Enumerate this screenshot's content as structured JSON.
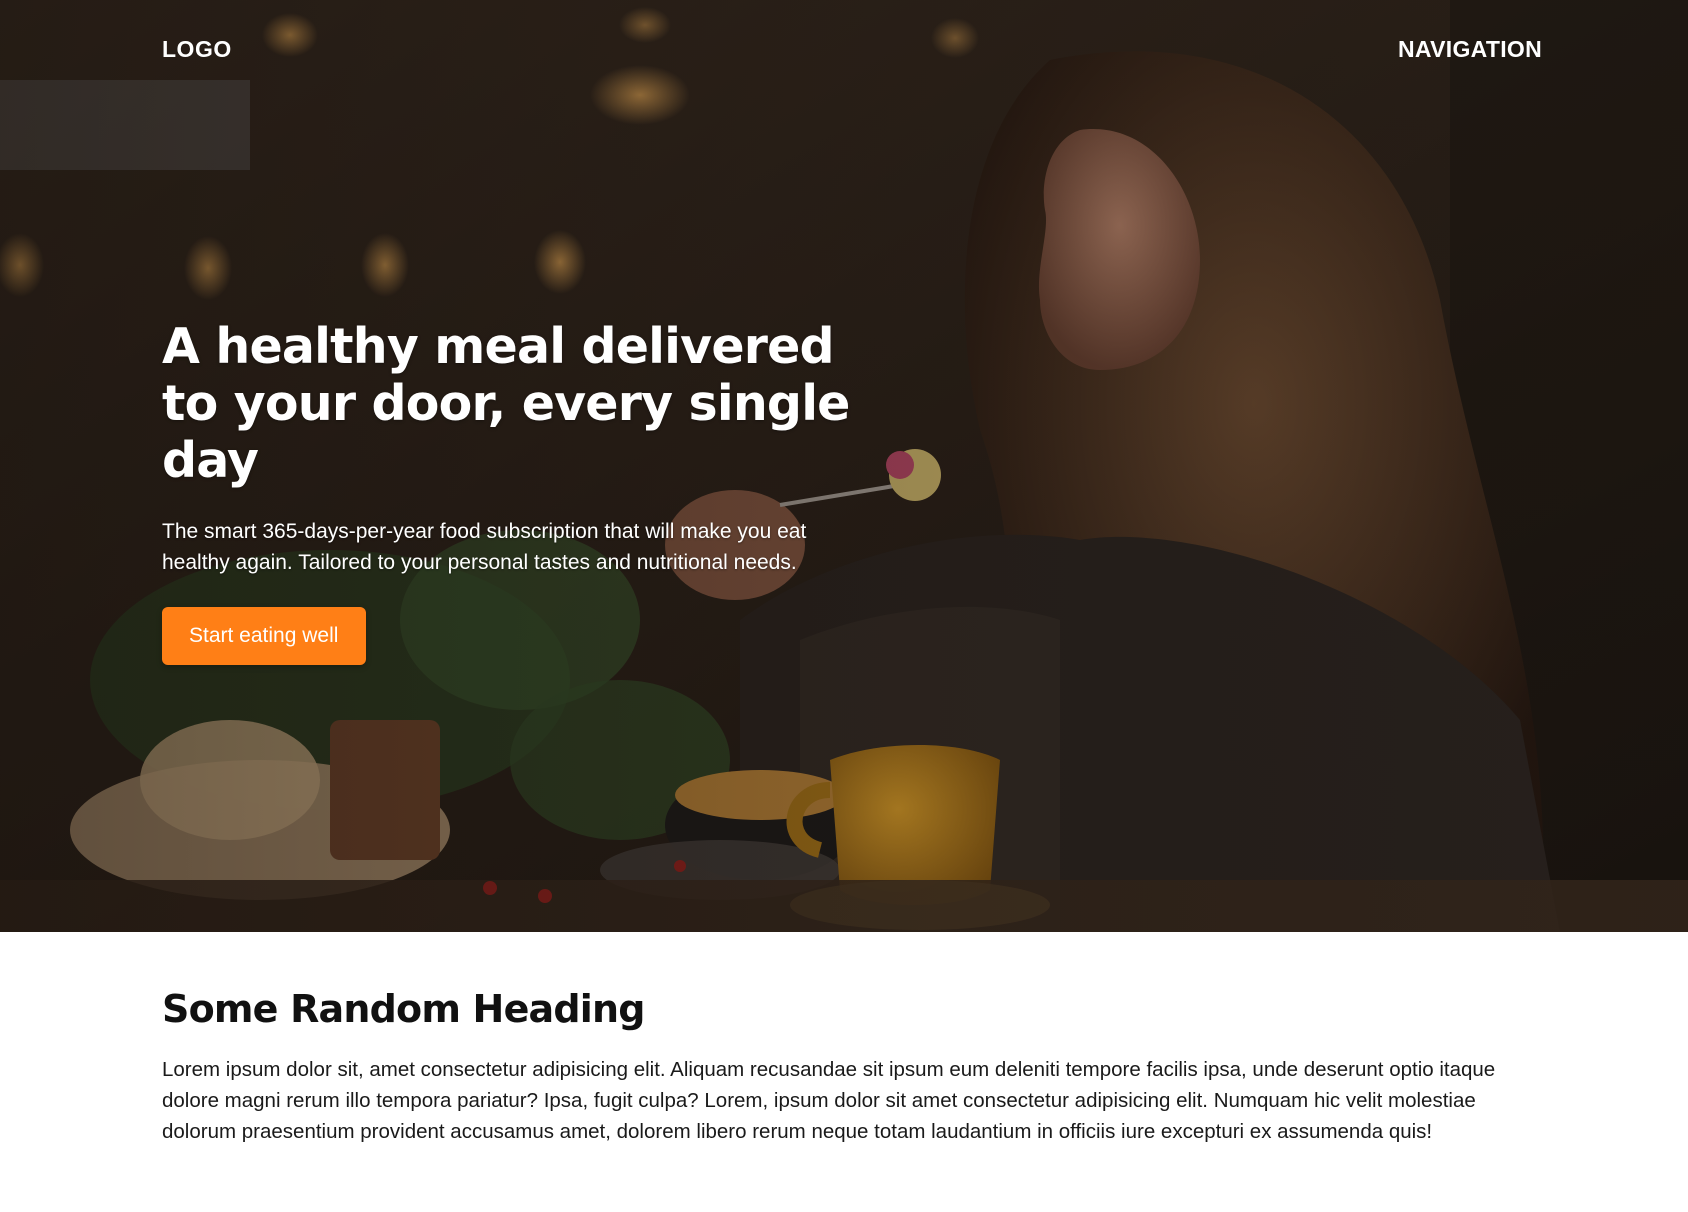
{
  "header": {
    "logo": "LOGO",
    "navigation": "NAVIGATION"
  },
  "hero": {
    "title": "A healthy meal delivered to your door, every single day",
    "text": "The smart 365-days-per-year food subscription that will make you eat healthy again. Tailored to your personal tastes and nutritional needs.",
    "cta_label": "Start eating well",
    "image": "woman-eating-in-restaurant-photo"
  },
  "section": {
    "heading": "Some Random Heading",
    "text": "Lorem ipsum dolor sit, amet consectetur adipisicing elit. Aliquam recusandae sit ipsum eum deleniti tempore facilis ipsa, unde deserunt optio itaque dolore magni rerum illo tempora pariatur? Ipsa, fugit culpa? Lorem, ipsum dolor sit amet consectetur adipisicing elit. Numquam hic velit molestiae dolorum praesentium provident accusamus amet, dolorem libero rerum neque totam laudantium in officiis iure excepturi ex assumenda quis!"
  },
  "colors": {
    "accent": "#ff7f16",
    "hero_text": "#ffffff",
    "body_text": "#111111",
    "background": "#ffffff"
  }
}
